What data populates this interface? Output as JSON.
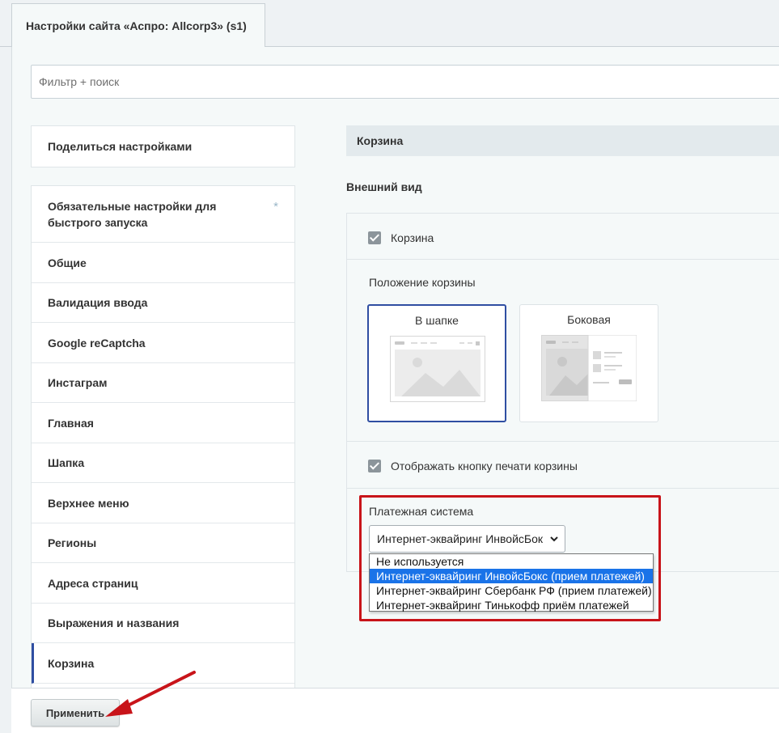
{
  "tab": {
    "title": "Настройки сайта «Аспро: Allcorp3» (s1)"
  },
  "filter": {
    "placeholder": "Фильтр + поиск"
  },
  "share_button": "Поделиться настройками",
  "sidebar": {
    "items": [
      {
        "label": "Обязательные настройки для быстрого запуска",
        "starred": true
      },
      {
        "label": "Общие"
      },
      {
        "label": "Валидация ввода"
      },
      {
        "label": "Google reCaptcha"
      },
      {
        "label": "Инстаграм"
      },
      {
        "label": "Главная"
      },
      {
        "label": "Шапка"
      },
      {
        "label": "Верхнее меню"
      },
      {
        "label": "Регионы"
      },
      {
        "label": "Адреса страниц"
      },
      {
        "label": "Выражения и названия"
      },
      {
        "label": "Корзина",
        "active": true
      }
    ],
    "star_glyph": "*"
  },
  "section": {
    "title": "Корзина",
    "subtitle": "Внешний вид",
    "basket_checkbox": {
      "label": "Корзина",
      "checked": true
    },
    "position": {
      "label": "Положение корзины",
      "options": [
        {
          "label": "В шапке",
          "selected": true
        },
        {
          "label": "Боковая",
          "selected": false
        }
      ]
    },
    "print_checkbox": {
      "label": "Отображать кнопку печати корзины",
      "checked": true
    },
    "payment": {
      "label": "Платежная система",
      "selected_text": "Интернет-эквайринг ИнвойсБок",
      "options": [
        {
          "label": "Не используется"
        },
        {
          "label": "Интернет-эквайринг ИнвойсБокс (прием платежей)",
          "highlighted": true
        },
        {
          "label": "Интернет-эквайринг Сбербанк РФ (прием платежей)"
        },
        {
          "label": "Интернет-эквайринг Тинькофф приём платежей"
        }
      ]
    }
  },
  "footer": {
    "apply_label": "Применить"
  },
  "colors": {
    "accent": "#2f4ea2",
    "highlight_box": "#c8141a",
    "option_selected": "#1a73e8",
    "arrow": "#c8141a"
  }
}
